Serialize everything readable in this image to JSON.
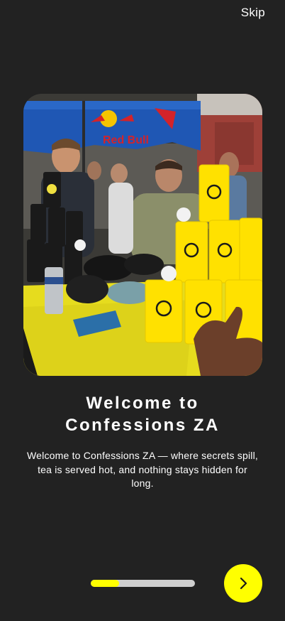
{
  "header": {
    "skip_label": "Skip"
  },
  "hero": {
    "alt": "Crowd at an event with stacks of yellow and black cups under a Red Bull umbrella",
    "umbrella_text": "Red Bull"
  },
  "onboarding": {
    "title_line1": "Welcome to",
    "title_line2": "Confessions ZA",
    "description": "Welcome to Confessions ZA — where secrets spill, tea is served hot, and nothing stays hidden for long."
  },
  "progress": {
    "value": 0.27
  },
  "next_button": {
    "icon": "chevron-right-icon"
  },
  "colors": {
    "background": "#222222",
    "accent": "#ffff00",
    "track": "#cfcfcf",
    "text": "#ffffff"
  }
}
